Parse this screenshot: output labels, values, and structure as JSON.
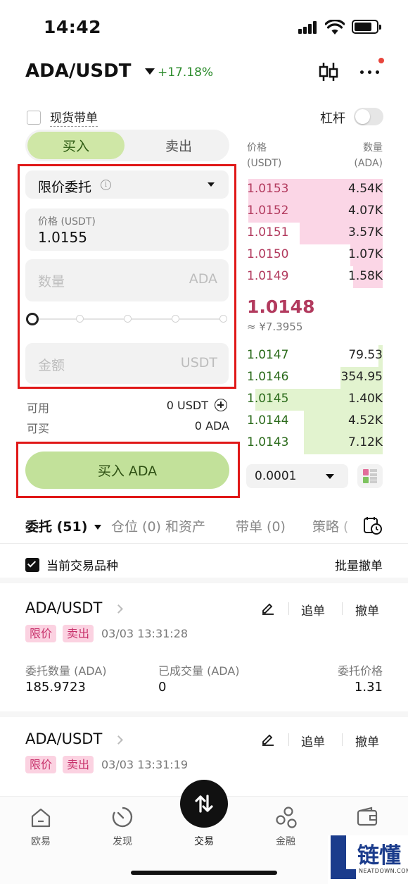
{
  "status_bar": {
    "time": "14:42"
  },
  "header": {
    "pair": "ADA/USDT",
    "change": "+17.18%"
  },
  "form": {
    "spot_follow_label": "现货带单",
    "leverage_label": "杠杆",
    "buy_tab": "买入",
    "sell_tab": "卖出",
    "order_type": "限价委托",
    "price_label": "价格 (USDT)",
    "price_value": "1.0155",
    "qty_placeholder": "数量",
    "qty_unit": "ADA",
    "amount_placeholder": "金额",
    "amount_unit": "USDT",
    "available_label": "可用",
    "available_value": "0 USDT",
    "buyable_label": "可买",
    "buyable_value": "0 ADA",
    "buy_button": "买入 ADA"
  },
  "orderbook": {
    "price_header_1": "价格",
    "price_header_2": "(USDT)",
    "qty_header_1": "数量",
    "qty_header_2": "(ADA)",
    "asks": [
      {
        "price": "1.0153",
        "qty": "4.54K",
        "depth": 0.99
      },
      {
        "price": "1.0152",
        "qty": "4.07K",
        "depth": 0.99
      },
      {
        "price": "1.0151",
        "qty": "3.57K",
        "depth": 0.61
      },
      {
        "price": "1.0150",
        "qty": "1.07K",
        "depth": 0.24
      },
      {
        "price": "1.0149",
        "qty": "1.58K",
        "depth": 0.22
      }
    ],
    "mid_price": "1.0148",
    "mid_fiat": "≈ ¥7.3955",
    "bids": [
      {
        "price": "1.0147",
        "qty": "79.53",
        "depth": 0.03
      },
      {
        "price": "1.0146",
        "qty": "354.95",
        "depth": 0.31
      },
      {
        "price": "1.0145",
        "qty": "1.40K",
        "depth": 0.94
      },
      {
        "price": "1.0144",
        "qty": "4.52K",
        "depth": 0.58
      },
      {
        "price": "1.0143",
        "qty": "7.12K",
        "depth": 0.58
      }
    ],
    "precision": "0.0001"
  },
  "tabs": [
    {
      "label": "委托 (51)"
    },
    {
      "label": "仓位 (0) 和资产"
    },
    {
      "label": "带单 (0)"
    },
    {
      "label": "策略 ("
    }
  ],
  "filter": {
    "current_pair_label": "当前交易品种",
    "batch_cancel": "批量撤单"
  },
  "orders": [
    {
      "pair": "ADA/USDT",
      "type_badge": "限价",
      "side_badge": "卖出",
      "time": "03/03 13:31:28",
      "qty_label": "委托数量 (ADA)",
      "qty": "185.9723",
      "filled_label": "已成交量 (ADA)",
      "filled": "0",
      "price_label": "委托价格",
      "price": "1.31",
      "chase_label": "追单",
      "cancel_label": "撤单"
    },
    {
      "pair": "ADA/USDT",
      "type_badge": "限价",
      "side_badge": "卖出",
      "time": "03/03 13:31:19",
      "chase_label": "追单",
      "cancel_label": "撤单"
    }
  ],
  "nav": {
    "items": [
      "欧易",
      "发现",
      "交易",
      "金融",
      ""
    ]
  },
  "watermark": {
    "brand": "链懂",
    "domain": "NEATDOWN.COM"
  },
  "colors": {
    "buy_green": "#c2e19a",
    "ask_red": "#b23a5e",
    "bid_green": "#2a6a1a",
    "highlight_box": "#e01818"
  }
}
